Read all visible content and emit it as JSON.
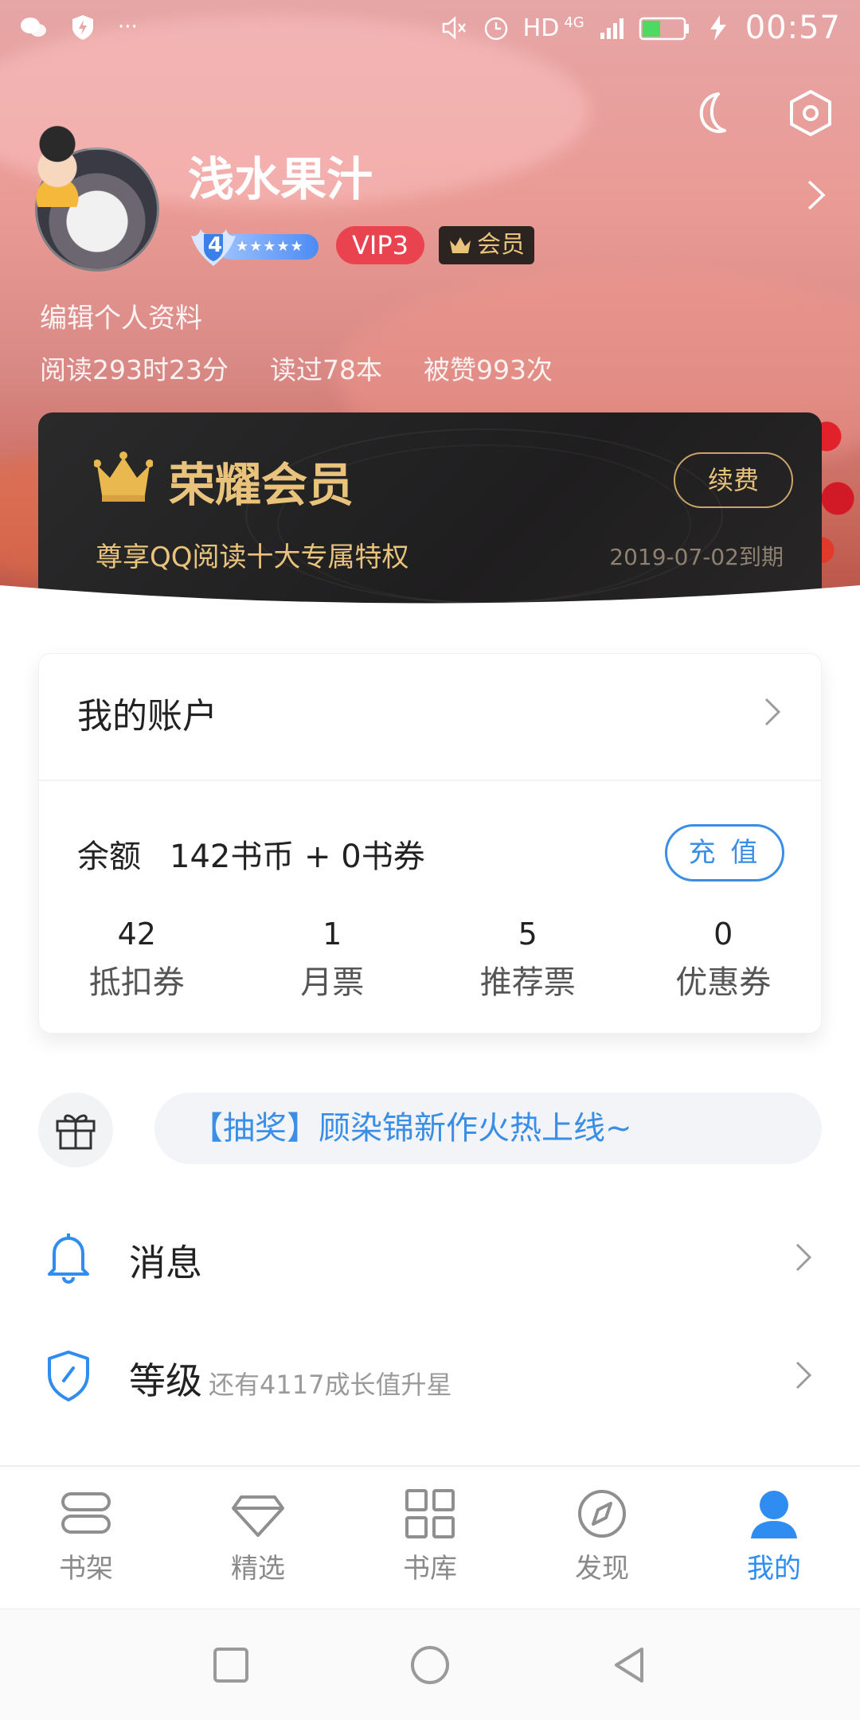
{
  "status_bar": {
    "time": "00:57",
    "network": "HD",
    "signal_label": "4G"
  },
  "profile": {
    "username": "浅水果汁",
    "level_number": "4",
    "level_stars": "★★★★★",
    "vip_label": "VIP3",
    "member_label": "会员",
    "edit_profile": "编辑个人资料",
    "stats": {
      "reading_time": "阅读293时23分",
      "books_read": "读过78本",
      "likes": "被赞993次"
    }
  },
  "vip_card": {
    "title": "荣耀会员",
    "subtitle": "尊享QQ阅读十大专属特权",
    "renew_label": "续费",
    "expire_text": "2019-07-02到期"
  },
  "account": {
    "title": "我的账户",
    "balance_label": "余额",
    "balance_value": "142书币 + 0书券",
    "recharge_label": "充 值",
    "tickets": [
      {
        "value": "42",
        "label": "抵扣券"
      },
      {
        "value": "1",
        "label": "月票"
      },
      {
        "value": "5",
        "label": "推荐票"
      },
      {
        "value": "0",
        "label": "优惠券"
      }
    ]
  },
  "promo": {
    "text": "【抽奖】顾染锦新作火热上线~"
  },
  "menu": {
    "messages_label": "消息",
    "level_label": "等级",
    "level_sub": "还有4117成长值升星"
  },
  "tabs": [
    {
      "label": "书架",
      "icon": "bookshelf-icon"
    },
    {
      "label": "精选",
      "icon": "diamond-icon"
    },
    {
      "label": "书库",
      "icon": "grid-icon"
    },
    {
      "label": "发现",
      "icon": "compass-icon"
    },
    {
      "label": "我的",
      "icon": "person-icon"
    }
  ],
  "colors": {
    "accent_blue": "#2f8cf0",
    "vip_gold": "#e9c37b",
    "vip_red": "#e8434f"
  }
}
